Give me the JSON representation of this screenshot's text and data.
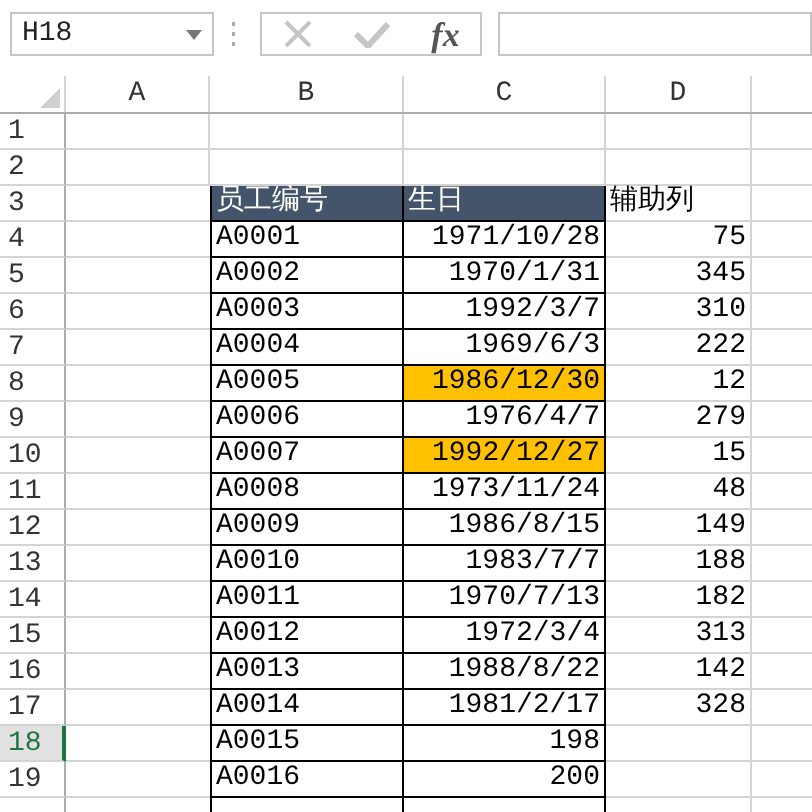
{
  "name_box": {
    "value": "H18"
  },
  "formula_bar": {
    "function_label": "fx"
  },
  "columns": [
    {
      "label": "A"
    },
    {
      "label": "B"
    },
    {
      "label": "C"
    },
    {
      "label": "D"
    }
  ],
  "rows": [
    {
      "number": "1",
      "kind": "blank",
      "selected": false
    },
    {
      "number": "2",
      "kind": "blank",
      "selected": false
    },
    {
      "number": "3",
      "kind": "header",
      "selected": false,
      "id": "员工编号",
      "date": "生日",
      "helper": "辅助列"
    },
    {
      "number": "4",
      "kind": "data",
      "selected": false,
      "id": "A0001",
      "date": "1971/10/28",
      "helper": "75",
      "highlighted": false
    },
    {
      "number": "5",
      "kind": "data",
      "selected": false,
      "id": "A0002",
      "date": "1970/1/31",
      "helper": "345",
      "highlighted": false
    },
    {
      "number": "6",
      "kind": "data",
      "selected": false,
      "id": "A0003",
      "date": "1992/3/7",
      "helper": "310",
      "highlighted": false
    },
    {
      "number": "7",
      "kind": "data",
      "selected": false,
      "id": "A0004",
      "date": "1969/6/3",
      "helper": "222",
      "highlighted": false
    },
    {
      "number": "8",
      "kind": "data",
      "selected": false,
      "id": "A0005",
      "date": "1986/12/30",
      "helper": "12",
      "highlighted": true
    },
    {
      "number": "9",
      "kind": "data",
      "selected": false,
      "id": "A0006",
      "date": "1976/4/7",
      "helper": "279",
      "highlighted": false
    },
    {
      "number": "10",
      "kind": "data",
      "selected": false,
      "id": "A0007",
      "date": "1992/12/27",
      "helper": "15",
      "highlighted": true
    },
    {
      "number": "11",
      "kind": "data",
      "selected": false,
      "id": "A0008",
      "date": "1973/11/24",
      "helper": "48",
      "highlighted": false
    },
    {
      "number": "12",
      "kind": "data",
      "selected": false,
      "id": "A0009",
      "date": "1986/8/15",
      "helper": "149",
      "highlighted": false
    },
    {
      "number": "13",
      "kind": "data",
      "selected": false,
      "id": "A0010",
      "date": "1983/7/7",
      "helper": "188",
      "highlighted": false
    },
    {
      "number": "14",
      "kind": "data",
      "selected": false,
      "id": "A0011",
      "date": "1970/7/13",
      "helper": "182",
      "highlighted": false
    },
    {
      "number": "15",
      "kind": "data",
      "selected": false,
      "id": "A0012",
      "date": "1972/3/4",
      "helper": "313",
      "highlighted": false
    },
    {
      "number": "16",
      "kind": "data",
      "selected": false,
      "id": "A0013",
      "date": "1988/8/22",
      "helper": "142",
      "highlighted": false
    },
    {
      "number": "17",
      "kind": "data",
      "selected": false,
      "id": "A0014",
      "date": "1981/2/17",
      "helper": "328",
      "highlighted": false
    },
    {
      "number": "18",
      "kind": "data",
      "selected": true,
      "id": "A0015",
      "date": "198",
      "highlighted": false
    },
    {
      "number": "19",
      "kind": "data",
      "selected": false,
      "id": "A0016",
      "date": "200",
      "highlighted": false
    }
  ]
}
